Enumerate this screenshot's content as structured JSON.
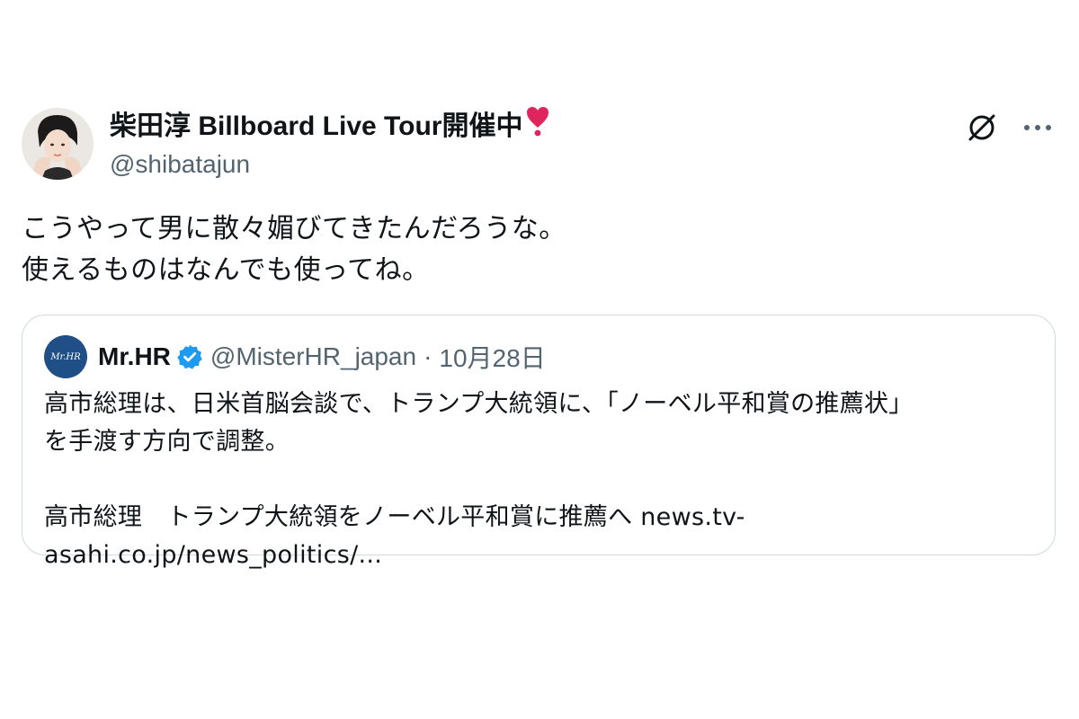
{
  "tweet": {
    "display_name": "柴田淳 Billboard Live Tour開催中",
    "name_emoji": "❣️",
    "handle": "@shibatajun",
    "text": "こうやって男に散々媚びてきたんだろうな。\n使えるものはなんでも使ってね。",
    "actions": {
      "grok_icon": "grok-icon",
      "more_icon": "more-icon",
      "more_glyph": "···"
    }
  },
  "quoted_tweet": {
    "avatar_text": "Mr.HR",
    "display_name": "Mr.HR",
    "handle": "@MisterHR_japan",
    "separator": "·",
    "date": "10月28日",
    "text": "高市総理は、日米首脳会談で、トランプ大統領に、「ノーベル平和賞の推薦状」\nを手渡す方向で調整。\n\n高市総理　トランプ大統領をノーベル平和賞に推薦へ news.tv-\nasahi.co.jp/news_politics/..."
  },
  "colors": {
    "text": "#0f1419",
    "secondary": "#536471",
    "border": "#cfd9de",
    "verified": "#1d9bf0",
    "emoji_heart": "#e0245e",
    "quote_avatar_bg": "#1f4f86"
  }
}
